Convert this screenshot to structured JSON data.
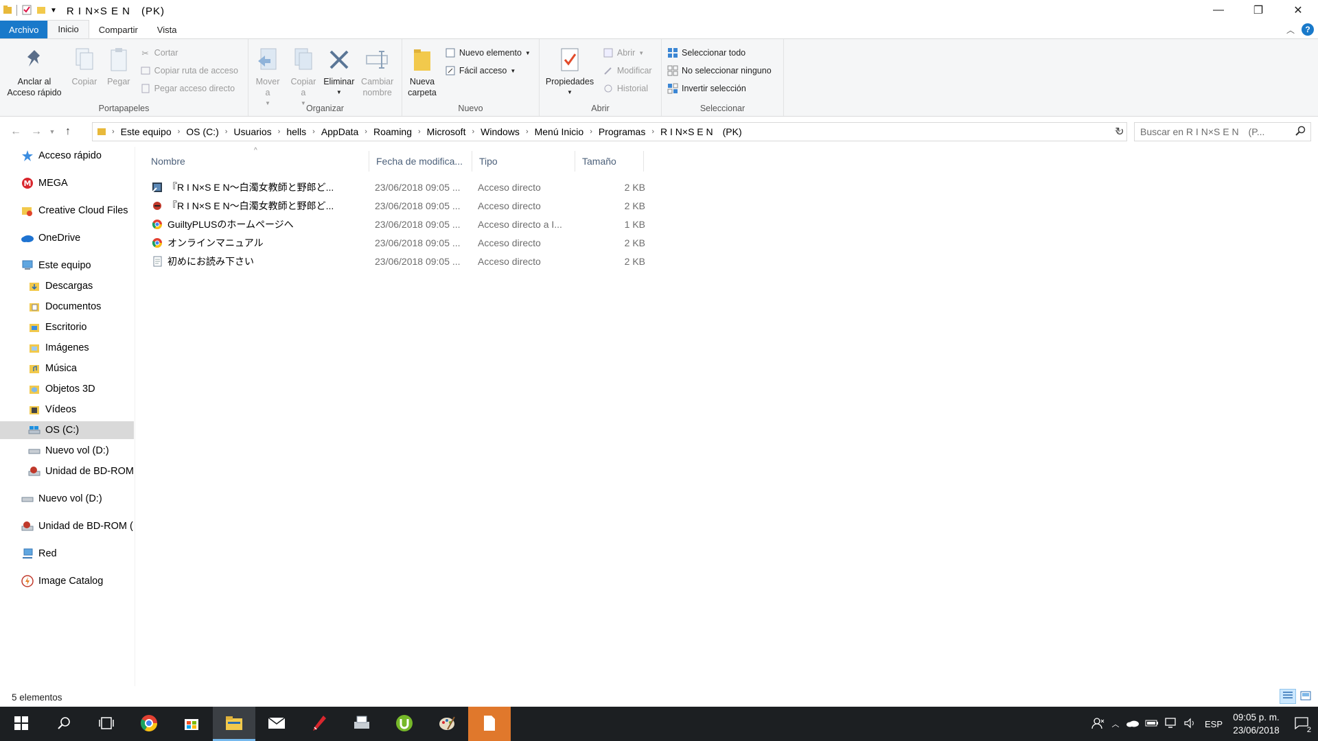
{
  "window": {
    "title": "R I N×S E N　(PK)"
  },
  "tabs": [
    {
      "label": "Archivo"
    },
    {
      "label": "Inicio"
    },
    {
      "label": "Compartir"
    },
    {
      "label": "Vista"
    }
  ],
  "ribbon": {
    "portapapeles": {
      "label": "Portapapeles",
      "anclar": "Anclar al Acceso rápido",
      "copiar": "Copiar",
      "pegar": "Pegar",
      "cortar": "Cortar",
      "copiar_ruta": "Copiar ruta de acceso",
      "pegar_acceso": "Pegar acceso directo"
    },
    "organizar": {
      "label": "Organizar",
      "mover": "Mover a",
      "copiar_a": "Copiar a",
      "eliminar": "Eliminar",
      "cambiar": "Cambiar nombre"
    },
    "nuevo": {
      "label": "Nuevo",
      "carpeta": "Nueva carpeta",
      "elemento": "Nuevo elemento",
      "facil": "Fácil acceso"
    },
    "abrir": {
      "label": "Abrir",
      "propiedades": "Propiedades",
      "abrir": "Abrir",
      "modificar": "Modificar",
      "historial": "Historial"
    },
    "seleccionar": {
      "label": "Seleccionar",
      "todo": "Seleccionar todo",
      "ninguno": "No seleccionar ninguno",
      "invertir": "Invertir selección"
    }
  },
  "address": {
    "crumbs": [
      "Este equipo",
      "OS (C:)",
      "Usuarios",
      "hells",
      "AppData",
      "Roaming",
      "Microsoft",
      "Windows",
      "Menú Inicio",
      "Programas",
      "R I N×S E N　(PK)"
    ]
  },
  "search": {
    "placeholder": "Buscar en R I N×S E N　(P..."
  },
  "sidebar": {
    "items": [
      {
        "label": "Acceso rápido",
        "icon": "star-icon"
      },
      {
        "label": "MEGA",
        "icon": "mega-icon"
      },
      {
        "label": "Creative Cloud Files",
        "icon": "creative-cloud-icon"
      },
      {
        "label": "OneDrive",
        "icon": "onedrive-icon"
      },
      {
        "label": "Este equipo",
        "icon": "computer-icon"
      },
      {
        "label": "Descargas",
        "icon": "downloads-folder-icon"
      },
      {
        "label": "Documentos",
        "icon": "documents-folder-icon"
      },
      {
        "label": "Escritorio",
        "icon": "desktop-folder-icon"
      },
      {
        "label": "Imágenes",
        "icon": "pictures-folder-icon"
      },
      {
        "label": "Música",
        "icon": "music-folder-icon"
      },
      {
        "label": "Objetos 3D",
        "icon": "3d-objects-folder-icon"
      },
      {
        "label": "Vídeos",
        "icon": "videos-folder-icon"
      },
      {
        "label": "OS (C:)",
        "icon": "drive-c-icon"
      },
      {
        "label": "Nuevo vol (D:)",
        "icon": "drive-d-icon"
      },
      {
        "label": "Unidad de BD-ROM",
        "icon": "bd-rom-icon"
      },
      {
        "label": "Nuevo vol (D:)",
        "icon": "drive-d-icon"
      },
      {
        "label": "Unidad de BD-ROM (",
        "icon": "bd-rom-icon"
      },
      {
        "label": "Red",
        "icon": "network-icon"
      },
      {
        "label": "Image Catalog",
        "icon": "image-catalog-icon"
      }
    ]
  },
  "filelist": {
    "headers": {
      "name": "Nombre",
      "date": "Fecha de modifica...",
      "type": "Tipo",
      "size": "Tamaño"
    },
    "rows": [
      {
        "name": "『R I N×S E N～白濁女教師と野郎ど...",
        "date": "23/06/2018 09:05 ...",
        "type": "Acceso directo",
        "size": "2 KB"
      },
      {
        "name": "『R I N×S E N～白濁女教師と野郎ど...",
        "date": "23/06/2018 09:05 ...",
        "type": "Acceso directo",
        "size": "2 KB"
      },
      {
        "name": "GuiltyPLUSのホームページへ",
        "date": "23/06/2018 09:05 ...",
        "type": "Acceso directo a I...",
        "size": "1 KB"
      },
      {
        "name": "オンラインマニュアル",
        "date": "23/06/2018 09:05 ...",
        "type": "Acceso directo",
        "size": "2 KB"
      },
      {
        "name": "初めにお読み下さい",
        "date": "23/06/2018 09:05 ...",
        "type": "Acceso directo",
        "size": "2 KB"
      }
    ]
  },
  "status": {
    "count": "5 elementos"
  },
  "taskbar": {
    "lang": "ESP",
    "time": "09:05 p. m.",
    "date": "23/06/2018",
    "notifications": "2"
  },
  "colors": {
    "accent": "#1979ca",
    "taskbar": "#1c1f22"
  }
}
